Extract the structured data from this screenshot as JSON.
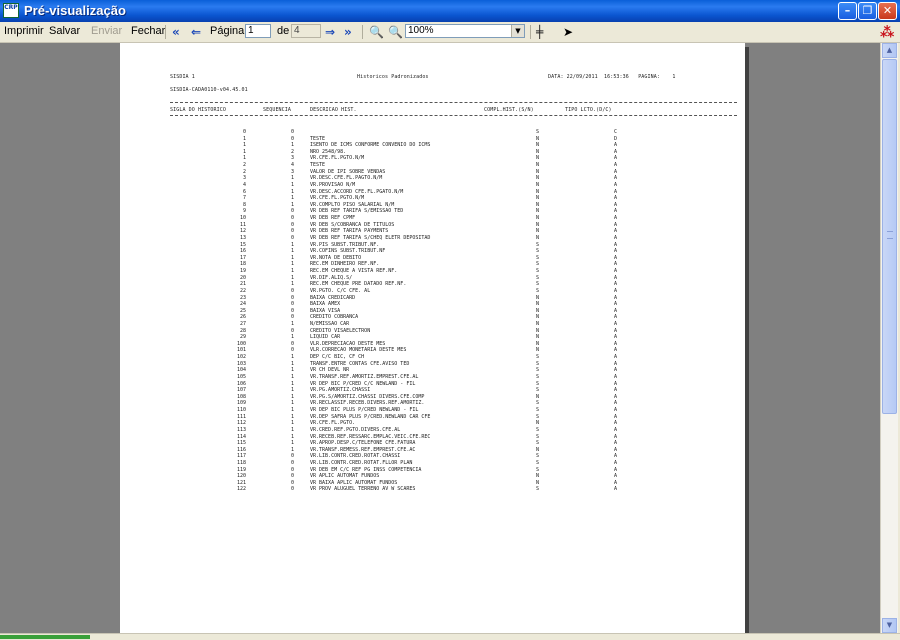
{
  "window": {
    "title": "Pré-visualização",
    "app_icon_text": "CRP"
  },
  "toolbar": {
    "print": "Imprimir",
    "save": "Salvar",
    "send": "Enviar",
    "close": "Fechar",
    "page_label": "Página",
    "page_value": "1",
    "of_label": "de",
    "total_pages": "4",
    "zoom": "100%"
  },
  "report": {
    "system": "SISDIA 1",
    "title": "Historicos Padronizados",
    "date_label": "DATA: 22/09/2011  16:53:36   PAGINA:    1",
    "program": "SISDIA-CADA0110-v04.45.01",
    "headers": {
      "sigla": "SIGLA DO HISTORICO",
      "sequencia": "SEQUENCIA",
      "descricao": "DESCRICAO HIST.",
      "compl": "COMPL.HIST.(S/N)",
      "tipo": "TIPO LCTO.(D/C)"
    },
    "rows": [
      [
        "0",
        "0",
        "",
        "S",
        "C"
      ],
      [
        "1",
        "0",
        "TESTE",
        "N",
        "D"
      ],
      [
        "1",
        "1",
        "ISENTO DE ICMS CONFORME CONVENIO DO ICMS",
        "N",
        "A"
      ],
      [
        "1",
        "2",
        "NRO 2548/98.",
        "N",
        "A"
      ],
      [
        "1",
        "3",
        "VR.CFE.FL.PGTO.N/M",
        "N",
        "A"
      ],
      [
        "2",
        "4",
        "TESTE",
        "N",
        "A"
      ],
      [
        "2",
        "3",
        "VALOR DE IPI SOBRE VENDAS",
        "N",
        "A"
      ],
      [
        "3",
        "1",
        "VR.DESC.CFE.FL.PAGTO.N/M",
        "N",
        "A"
      ],
      [
        "4",
        "1",
        "VR.PROVISAO N/M",
        "N",
        "A"
      ],
      [
        "6",
        "1",
        "VR.DESC.ACCORD CFE.FL.PGATO.N/M",
        "N",
        "A"
      ],
      [
        "7",
        "1",
        "VR.CFE.FL.PGTO.N/M",
        "N",
        "A"
      ],
      [
        "8",
        "1",
        "VR.COMPLTO PISO SALARIAL N/M",
        "N",
        "A"
      ],
      [
        "9",
        "0",
        "VR DEB REF TARIFA S/EMISSAO TED",
        "N",
        "A"
      ],
      [
        "10",
        "0",
        "VR DEB REF CPMF",
        "N",
        "A"
      ],
      [
        "11",
        "0",
        "VR DEB S/COBRANCA DE TITULOS",
        "N",
        "A"
      ],
      [
        "12",
        "0",
        "VR DEB REF TARIFA PAYMENTS",
        "N",
        "A"
      ],
      [
        "13",
        "0",
        "VR DEB REF TARIFA S/CHEQ ELETR DEPOSITAD",
        "N",
        "A"
      ],
      [
        "15",
        "1",
        "VR.PIS SUBST.TRIBUT.NF.",
        "S",
        "A"
      ],
      [
        "16",
        "1",
        "VR.COFINS SUBST.TRIBUT.NF",
        "S",
        "A"
      ],
      [
        "17",
        "1",
        "VR.NOTA DE DEBITO",
        "S",
        "A"
      ],
      [
        "18",
        "1",
        "REC.EM DINHEIRO REF.NF.",
        "S",
        "A"
      ],
      [
        "19",
        "1",
        "REC.EM CHEQUE A VISTA REF.NF.",
        "S",
        "A"
      ],
      [
        "20",
        "1",
        "VR.DIF.ALIQ.S/",
        "S",
        "A"
      ],
      [
        "21",
        "1",
        "REC.EM CHEQUE PRE DATADO REF.NF.",
        "S",
        "A"
      ],
      [
        "22",
        "0",
        "VR.PGTO. C/C CFE. AL",
        "S",
        "A"
      ],
      [
        "23",
        "0",
        "BAIXA CREDICARD",
        "N",
        "A"
      ],
      [
        "24",
        "0",
        "BAIXA AMEX",
        "N",
        "A"
      ],
      [
        "25",
        "0",
        "BAIXA VISA",
        "N",
        "A"
      ],
      [
        "26",
        "0",
        "CREDITO COBRANCA",
        "N",
        "A"
      ],
      [
        "27",
        "1",
        "N/EMISSAO CAR",
        "N",
        "A"
      ],
      [
        "28",
        "0",
        "CREDITO VISAELECTRON",
        "N",
        "A"
      ],
      [
        "29",
        "1",
        "LIQUID CAR",
        "N",
        "A"
      ],
      [
        "100",
        "0",
        "VLR.DEPRECIACAO DESTE MES",
        "N",
        "A"
      ],
      [
        "101",
        "0",
        "VLR.CORRECAO MONETARIA DESTE MES",
        "N",
        "A"
      ],
      [
        "102",
        "1",
        "DEP C/C BIC, CF CH",
        "S",
        "A"
      ],
      [
        "103",
        "1",
        "TRANSF.ENTRE CONTAS CFE.AVISO TED",
        "S",
        "A"
      ],
      [
        "104",
        "1",
        "VR CH DEVL NR",
        "S",
        "A"
      ],
      [
        "105",
        "1",
        "VR.TRANSF.REF.AMORTIZ.EMPREST.CFE.AL",
        "S",
        "A"
      ],
      [
        "106",
        "1",
        "VR DEP BIC P/CRED C/C NEWLAND - FIL",
        "S",
        "A"
      ],
      [
        "107",
        "1",
        "VR.PG.AMORTIZ.CHASSI",
        "S",
        "A"
      ],
      [
        "108",
        "1",
        "VR.PG.S/AMORTIZ.CHASSI DIVERS.CFE.COMP",
        "N",
        "A"
      ],
      [
        "109",
        "1",
        "VR.RECLASSIF.RECEB.DIVERS.REF.AMORTIZ.",
        "S",
        "A"
      ],
      [
        "110",
        "1",
        "VR DEP BIC PLUS P/CRED NEWLAND - FIL",
        "S",
        "A"
      ],
      [
        "111",
        "1",
        "VR.DEP SAFRA PLUS P/CRED.NEWLAND CAR CFE",
        "S",
        "A"
      ],
      [
        "112",
        "1",
        "VR.CFE.FL.PGTO.",
        "N",
        "A"
      ],
      [
        "113",
        "1",
        "VR.CRED.REF.PGTO.DIVERS.CFE.AL",
        "S",
        "A"
      ],
      [
        "114",
        "1",
        "VR.RECEB.REF.RESSARC.EMPLAC.VEIC.CFE.REC",
        "S",
        "A"
      ],
      [
        "115",
        "1",
        "VR.APROP.DESP.C/TELEFONE CFE.FATURA",
        "S",
        "A"
      ],
      [
        "116",
        "1",
        "VR.TRANSF.REMESS.REF.EMPREST.CFE.AC",
        "N",
        "A"
      ],
      [
        "117",
        "0",
        "VR.LIB.CONTR.CRED.ROTAT.CHASSI",
        "S",
        "A"
      ],
      [
        "118",
        "0",
        "VR.LIB.CONTR.CRED.ROTAT.FLLOR PLAN",
        "S",
        "A"
      ],
      [
        "119",
        "0",
        "VR DEB EM C/C REF PG INSS COMPETENCIA",
        "S",
        "A"
      ],
      [
        "120",
        "0",
        "VR APLIC AUTOMAT FUNDOS",
        "N",
        "A"
      ],
      [
        "121",
        "0",
        "VR BAIXA APLIC AUTOMAT FUNDOS",
        "N",
        "A"
      ],
      [
        "122",
        "0",
        "VR PROV ALUGUEL TERRENO AV W SCARES",
        "S",
        "A"
      ]
    ]
  }
}
